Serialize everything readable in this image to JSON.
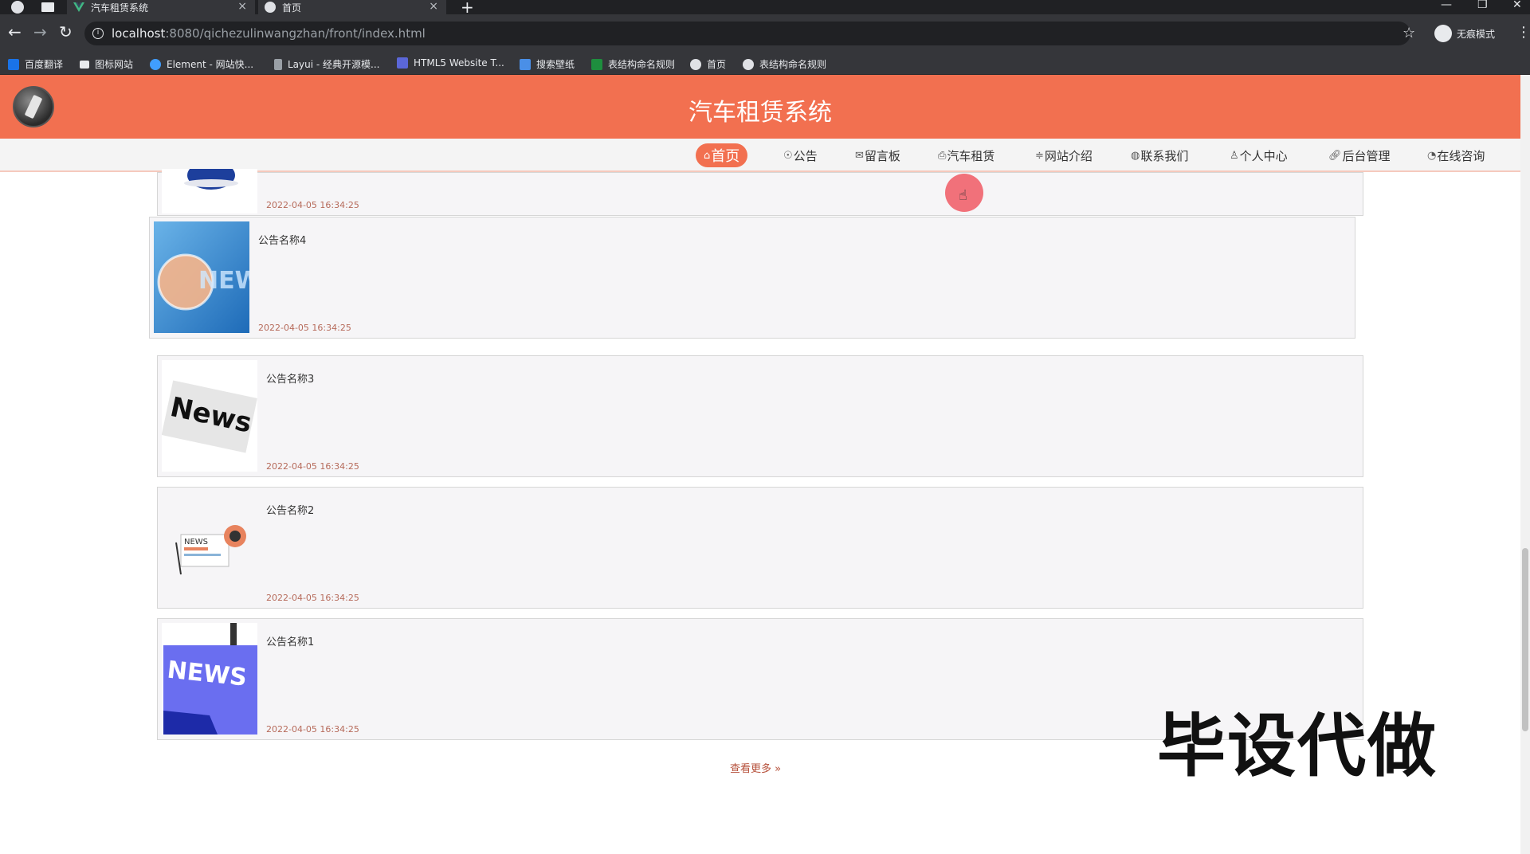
{
  "browser": {
    "tabs": [
      {
        "title": "汽车租赁系统",
        "close": "×"
      },
      {
        "title": "首页",
        "close": "×"
      }
    ],
    "new_tab": "+",
    "url_host": "localhost",
    "url_path": ":8080/qichezulinwangzhan/front/index.html",
    "profile_label": "无痕模式",
    "bookmarks": [
      "百度翻译",
      "图标网站",
      "Element - 网站快...",
      "Layui - 经典开源模...",
      "HTML5 Website T...",
      "搜索壁纸",
      "表结构命名规则",
      "首页",
      "表结构命名规则"
    ]
  },
  "site": {
    "title": "汽车租赁系统",
    "menu": [
      "首页",
      "公告",
      "留言板",
      "汽车租赁",
      "网站介绍",
      "联系我们",
      "个人中心",
      "后台管理",
      "在线咨询"
    ]
  },
  "notices": [
    {
      "name": "",
      "date": "2022-04-05 16:34:25"
    },
    {
      "name": "公告名称4",
      "date": "2022-04-05 16:34:25"
    },
    {
      "name": "公告名称3",
      "date": "2022-04-05 16:34:25"
    },
    {
      "name": "公告名称2",
      "date": "2022-04-05 16:34:25"
    },
    {
      "name": "公告名称1",
      "date": "2022-04-05 16:34:25"
    }
  ],
  "more_label": "查看更多 »",
  "watermark": "毕设代做",
  "colors": {
    "accent": "#f27050",
    "date_text": "#b66a5a"
  }
}
